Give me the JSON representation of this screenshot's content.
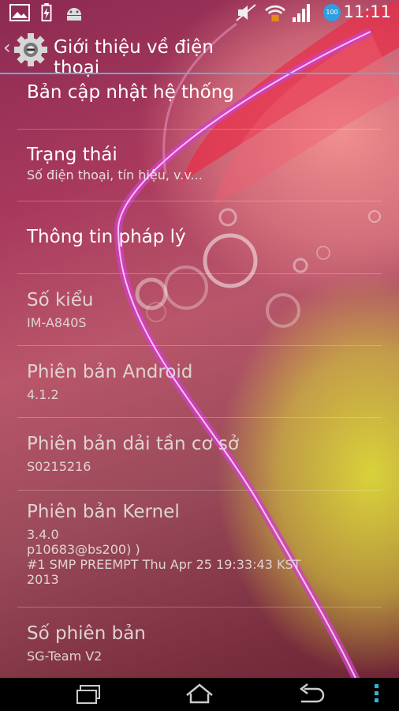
{
  "status_bar": {
    "time": "11:11",
    "icons": [
      "gallery-notification-icon",
      "battery-charging-icon",
      "android-debug-icon",
      "mute-icon",
      "wifi-lock-icon",
      "signal-bars-icon",
      "battery-level-badge-icon"
    ],
    "battery_badge": "100"
  },
  "action_bar": {
    "title": "Giới thiệu về điện thoại",
    "accent_color": "#4fb6d9"
  },
  "items": [
    {
      "title": "Bản cập nhật hệ thống",
      "subtitle": ""
    },
    {
      "title": "Trạng thái",
      "subtitle": "Số điện thoại, tín hiệu, v.v..."
    },
    {
      "title": "Thông tin pháp lý",
      "subtitle": ""
    },
    {
      "title": "Số kiểu",
      "subtitle": "IM-A840S"
    },
    {
      "title": "Phiên bản Android",
      "subtitle": "4.1.2"
    },
    {
      "title": "Phiên bản dải tần cơ sở",
      "subtitle": "S0215216"
    },
    {
      "title": "Phiên bản Kernel",
      "subtitle_lines": [
        "3.4.0",
        "p10683@bs200) )",
        "#1 SMP PREEMPT Thu Apr 25 19:33:43 KST",
        "2013"
      ]
    },
    {
      "title": "Số phiên bản",
      "subtitle": "SG-Team V2"
    }
  ],
  "nav_bar": {
    "buttons": [
      "recent-apps-icon",
      "home-icon",
      "back-icon",
      "overflow-menu-icon"
    ]
  }
}
